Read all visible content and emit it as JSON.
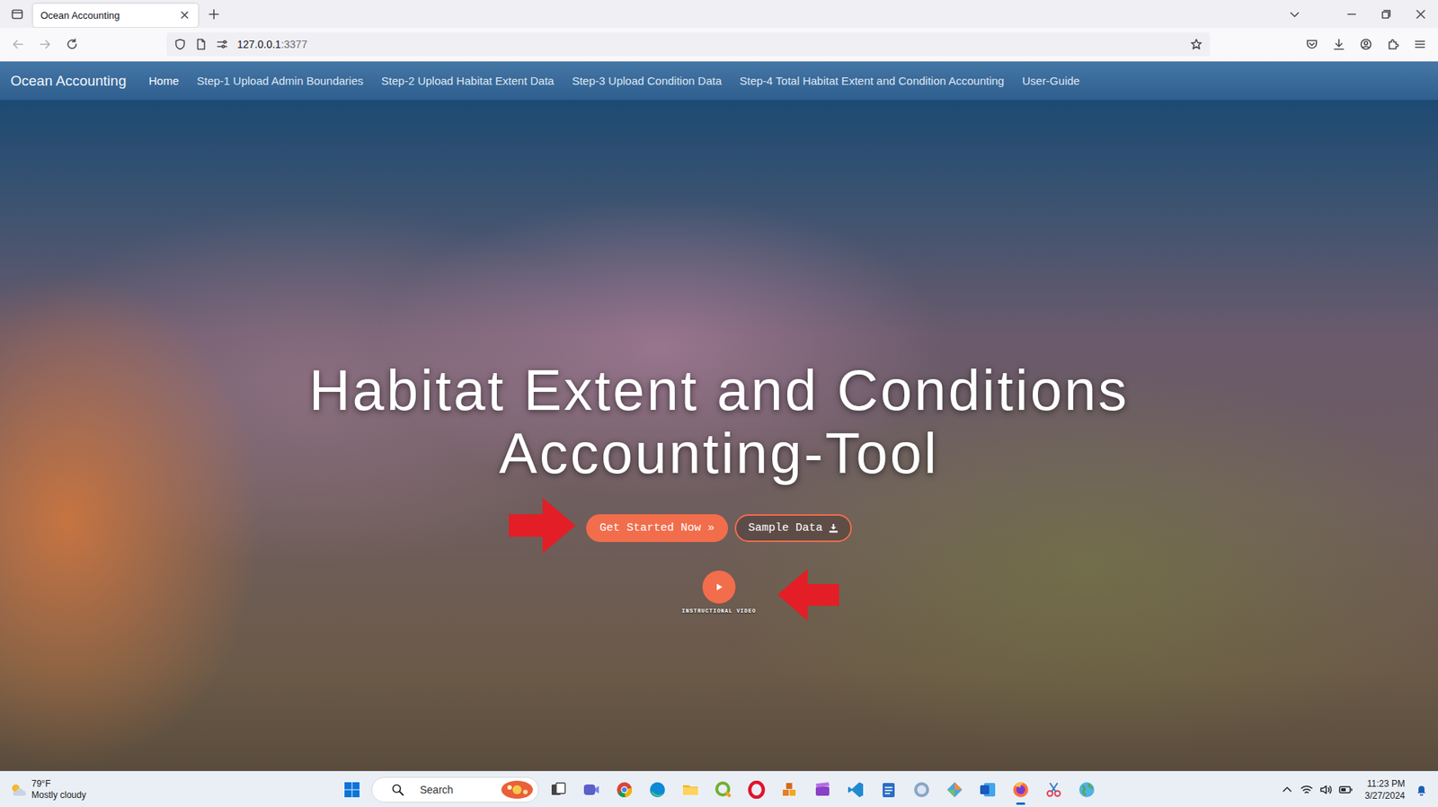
{
  "browser": {
    "tabs": [
      {
        "label": "Ocean Accounting",
        "selected": true
      }
    ],
    "url": {
      "host": "127.0.0.1",
      "port": ":3377"
    }
  },
  "navbar": {
    "brand": "Ocean Accounting",
    "items": [
      {
        "label": "Home",
        "selected": true
      },
      {
        "label": "Step-1 Upload Admin Boundaries",
        "selected": false
      },
      {
        "label": "Step-2 Upload Habitat Extent Data",
        "selected": false
      },
      {
        "label": "Step-3 Upload Condition Data",
        "selected": false
      },
      {
        "label": "Step-4 Total Habitat Extent and Condition Accounting",
        "selected": false
      },
      {
        "label": "User-Guide",
        "selected": false
      }
    ]
  },
  "hero": {
    "title": [
      "Habitat Extent and Conditions",
      "Accounting-Tool"
    ],
    "primary_button": "Get Started Now »",
    "secondary_button": "Sample Data",
    "video_label": "INSTRUCTIONAL VIDEO"
  },
  "taskbar": {
    "weather": {
      "temp": "79°F",
      "condition": "Mostly cloudy"
    },
    "search": {
      "placeholder": "Search"
    },
    "clock": {
      "time": "11:23 PM",
      "date": "3/27/2024"
    }
  }
}
